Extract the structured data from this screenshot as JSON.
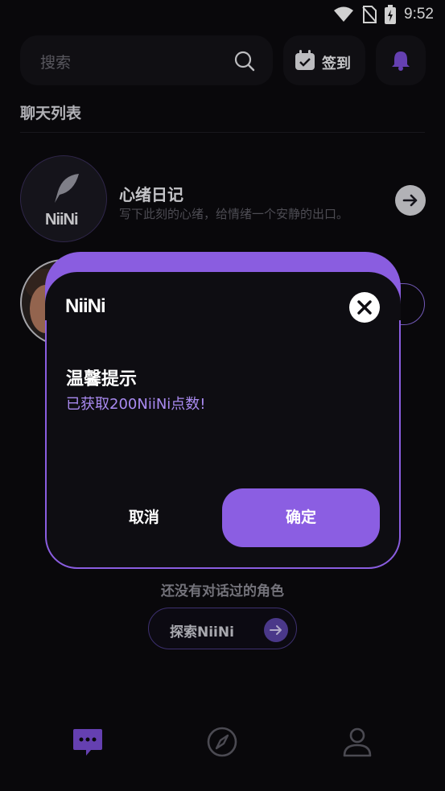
{
  "status_bar": {
    "time": "9:52",
    "icons": [
      "wifi-icon",
      "no-sim-icon",
      "battery-charging-icon"
    ]
  },
  "header": {
    "search_placeholder": "搜索",
    "checkin_label": "签到"
  },
  "section_title": "聊天列表",
  "chats": [
    {
      "name": "心绪日记",
      "desc": "写下此刻的心绪，给情绪一个安静的出口。",
      "avatar_text": "NiiNi"
    }
  ],
  "empty_state": {
    "text": "还没有对话过的角色",
    "explore_label": "探索NiiNi"
  },
  "modal": {
    "logo": "NiiNi",
    "title": "温馨提示",
    "message": "已获取200NiiNi点数!",
    "cancel_label": "取消",
    "confirm_label": "确定"
  },
  "colors": {
    "accent": "#8b5ee2",
    "background": "#0b0a0e",
    "message_text": "#a98af0"
  },
  "bottom_nav": [
    "chat-icon",
    "compass-icon",
    "profile-icon"
  ]
}
